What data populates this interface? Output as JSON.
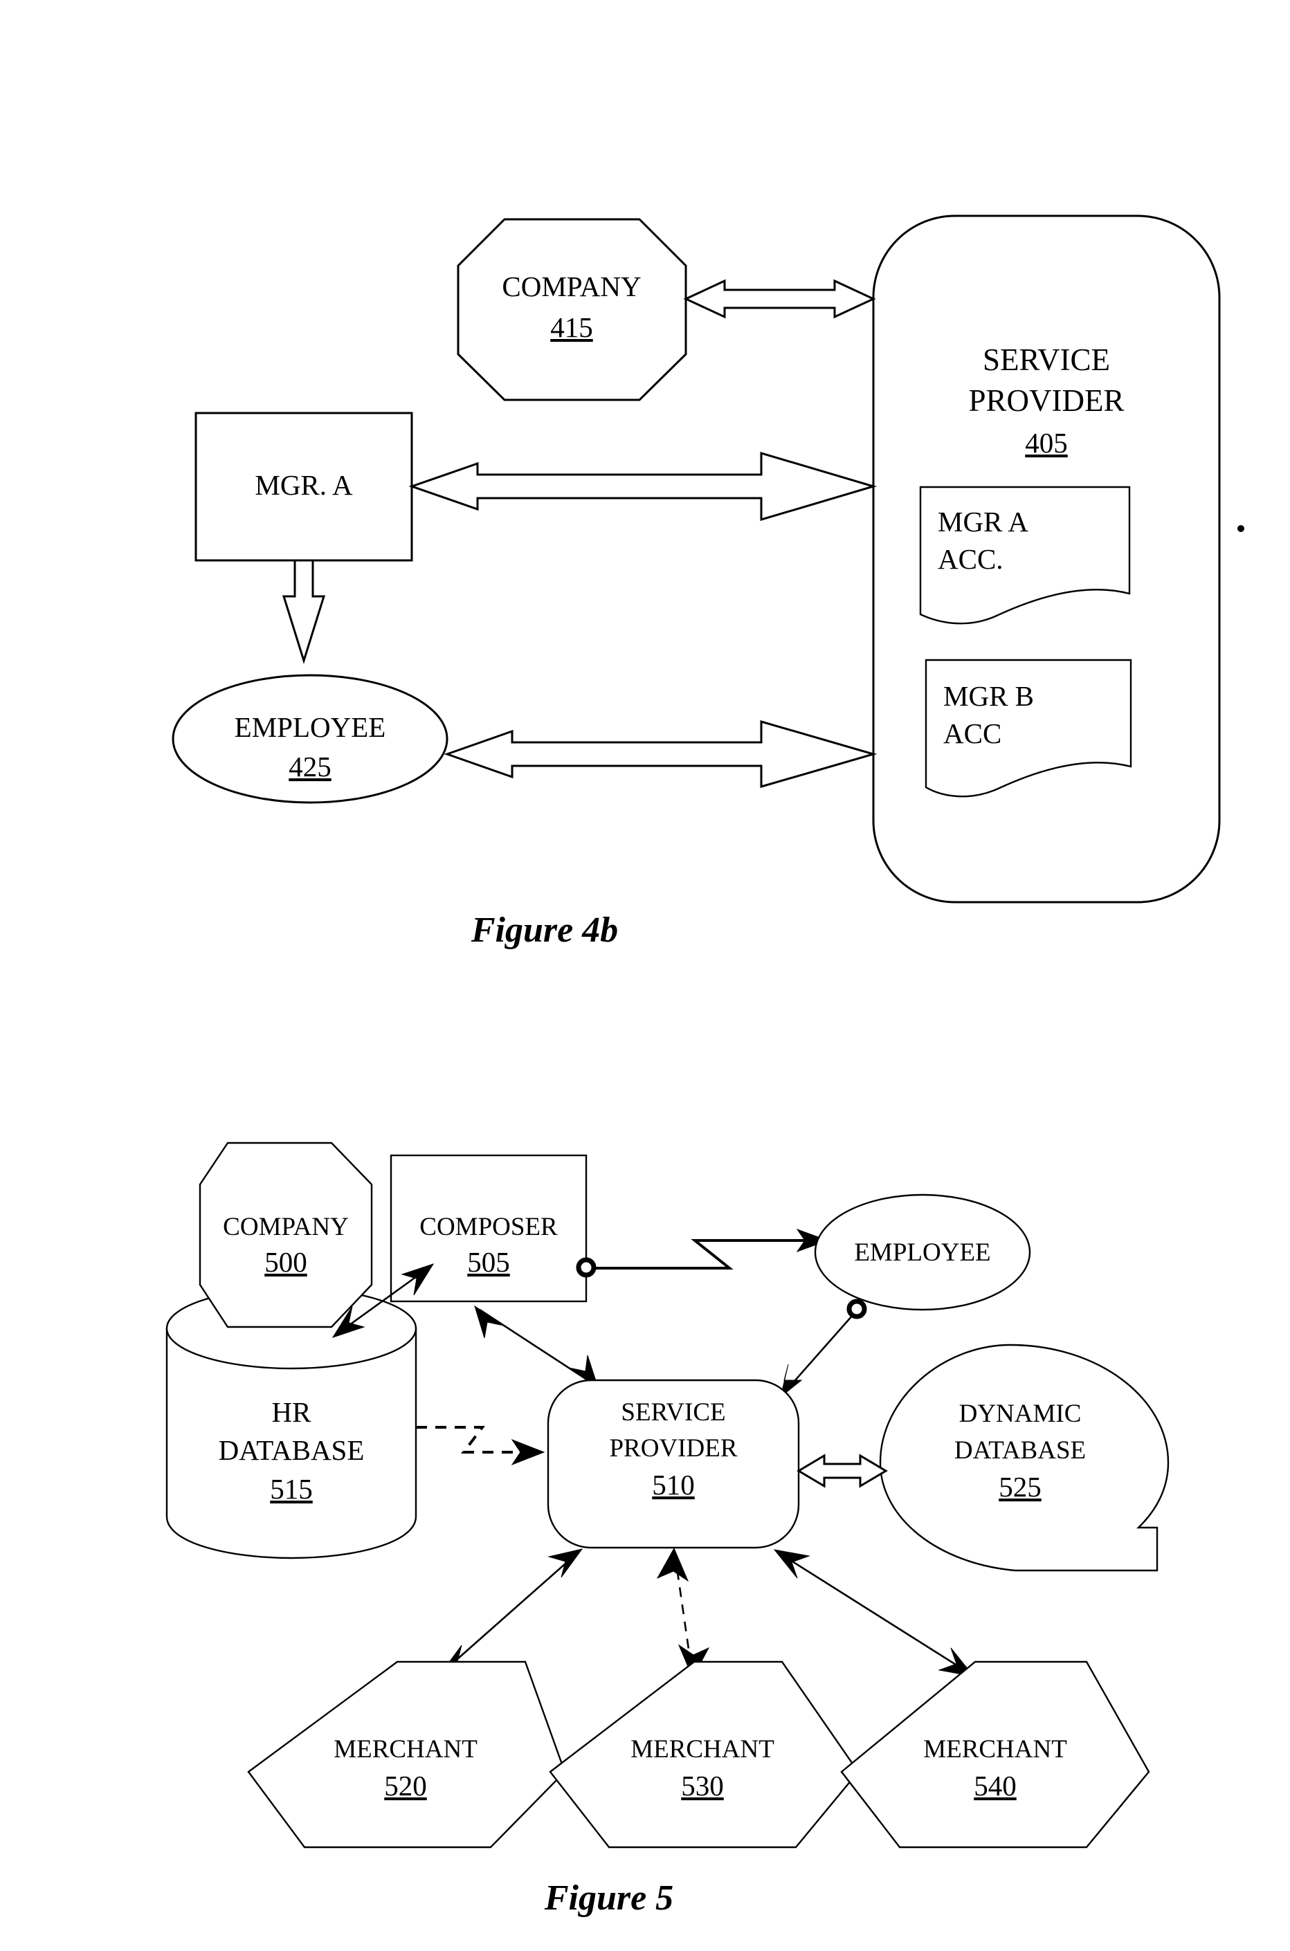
{
  "document": {
    "type": "patent-figure-sheet",
    "figures": [
      {
        "caption": "Figure 4b",
        "nodes": [
          {
            "name": "company",
            "shape": "octagon",
            "label": "COMPANY",
            "ref": "415"
          },
          {
            "name": "service-provider",
            "shape": "rounded-rectangle",
            "label_line1": "SERVICE",
            "label_line2": "PROVIDER",
            "ref": "405"
          },
          {
            "name": "mgr-a",
            "shape": "rectangle",
            "label": "MGR.  A",
            "ref": ""
          },
          {
            "name": "employee",
            "shape": "ellipse",
            "label": "EMPLOYEE",
            "ref": "425"
          },
          {
            "name": "mgr-a-acc",
            "shape": "document",
            "label_line1": "MGR A",
            "label_line2": "ACC.",
            "ref": ""
          },
          {
            "name": "mgr-b-acc",
            "shape": "document",
            "label_line1": "MGR B",
            "label_line2": "ACC",
            "ref": ""
          }
        ],
        "connectors": [
          {
            "from": "company",
            "to": "service-provider",
            "style": "hollow-double-arrow"
          },
          {
            "from": "mgr-a",
            "to": "service-provider",
            "style": "hollow-double-arrow"
          },
          {
            "from": "employee",
            "to": "service-provider",
            "style": "hollow-double-arrow"
          },
          {
            "from": "mgr-a",
            "to": "employee",
            "style": "hollow-down-arrow"
          }
        ]
      },
      {
        "caption": "Figure 5",
        "nodes": [
          {
            "name": "company",
            "shape": "octagon",
            "label": "COMPANY",
            "ref": "500"
          },
          {
            "name": "composer",
            "shape": "rectangle",
            "label": "COMPOSER",
            "ref": "505"
          },
          {
            "name": "employee",
            "shape": "ellipse",
            "label": "EMPLOYEE",
            "ref": ""
          },
          {
            "name": "hr-database",
            "shape": "cylinder",
            "label_line1": "HR",
            "label_line2": "DATABASE",
            "ref": "515"
          },
          {
            "name": "service-provider",
            "shape": "rounded-rectangle",
            "label_line1": "SERVICE",
            "label_line2": "PROVIDER",
            "ref": "510"
          },
          {
            "name": "dynamic-database",
            "shape": "callout-circle",
            "label_line1": "DYNAMIC",
            "label_line2": "DATABASE",
            "ref": "525"
          },
          {
            "name": "merchant-520",
            "shape": "pentagon",
            "label": "MERCHANT",
            "ref": "520"
          },
          {
            "name": "merchant-530",
            "shape": "pentagon",
            "label": "MERCHANT",
            "ref": "530"
          },
          {
            "name": "merchant-540",
            "shape": "pentagon",
            "label": "MERCHANT",
            "ref": "540"
          }
        ],
        "connectors": [
          {
            "from": "composer",
            "to": "employee",
            "style": "zigzag-arrow"
          },
          {
            "from": "hr-database",
            "to": "composer",
            "style": "double-arrow"
          },
          {
            "from": "hr-database",
            "to": "service-provider",
            "style": "dashed-zigzag-arrow"
          },
          {
            "from": "composer",
            "to": "service-provider",
            "style": "double-arrow"
          },
          {
            "from": "employee",
            "to": "service-provider",
            "style": "single-arrow"
          },
          {
            "from": "service-provider",
            "to": "dynamic-database",
            "style": "hollow-double-arrow"
          },
          {
            "from": "service-provider",
            "to": "merchant-520",
            "style": "double-arrow"
          },
          {
            "from": "service-provider",
            "to": "merchant-530",
            "style": "dashed-double-arrow"
          },
          {
            "from": "service-provider",
            "to": "merchant-540",
            "style": "double-arrow"
          }
        ]
      }
    ]
  },
  "fig4b": {
    "caption": "Figure 4b",
    "company": {
      "label": "COMPANY",
      "ref": "415"
    },
    "service_provider": {
      "line1": "SERVICE",
      "line2": "PROVIDER",
      "ref": "405"
    },
    "mgr_a": {
      "label": "MGR.  A"
    },
    "employee": {
      "label": "EMPLOYEE",
      "ref": "425"
    },
    "mgr_a_acc": {
      "line1": "MGR A",
      "line2": "ACC."
    },
    "mgr_b_acc": {
      "line1": "MGR B",
      "line2": "ACC"
    }
  },
  "fig5": {
    "caption": "Figure 5",
    "company": {
      "label": "COMPANY",
      "ref": "500"
    },
    "composer": {
      "label": "COMPOSER",
      "ref": "505"
    },
    "employee": {
      "label": "EMPLOYEE"
    },
    "hr_database": {
      "line1": "HR",
      "line2": "DATABASE",
      "ref": "515"
    },
    "service_provider": {
      "line1": "SERVICE",
      "line2": "PROVIDER",
      "ref": "510"
    },
    "dynamic_database": {
      "line1": "DYNAMIC",
      "line2": "DATABASE",
      "ref": "525"
    },
    "merchant_520": {
      "label": "MERCHANT",
      "ref": "520"
    },
    "merchant_530": {
      "label": "MERCHANT",
      "ref": "530"
    },
    "merchant_540": {
      "label": "MERCHANT",
      "ref": "540"
    }
  },
  "colors": {
    "ink": "#000000",
    "paper": "#ffffff"
  }
}
